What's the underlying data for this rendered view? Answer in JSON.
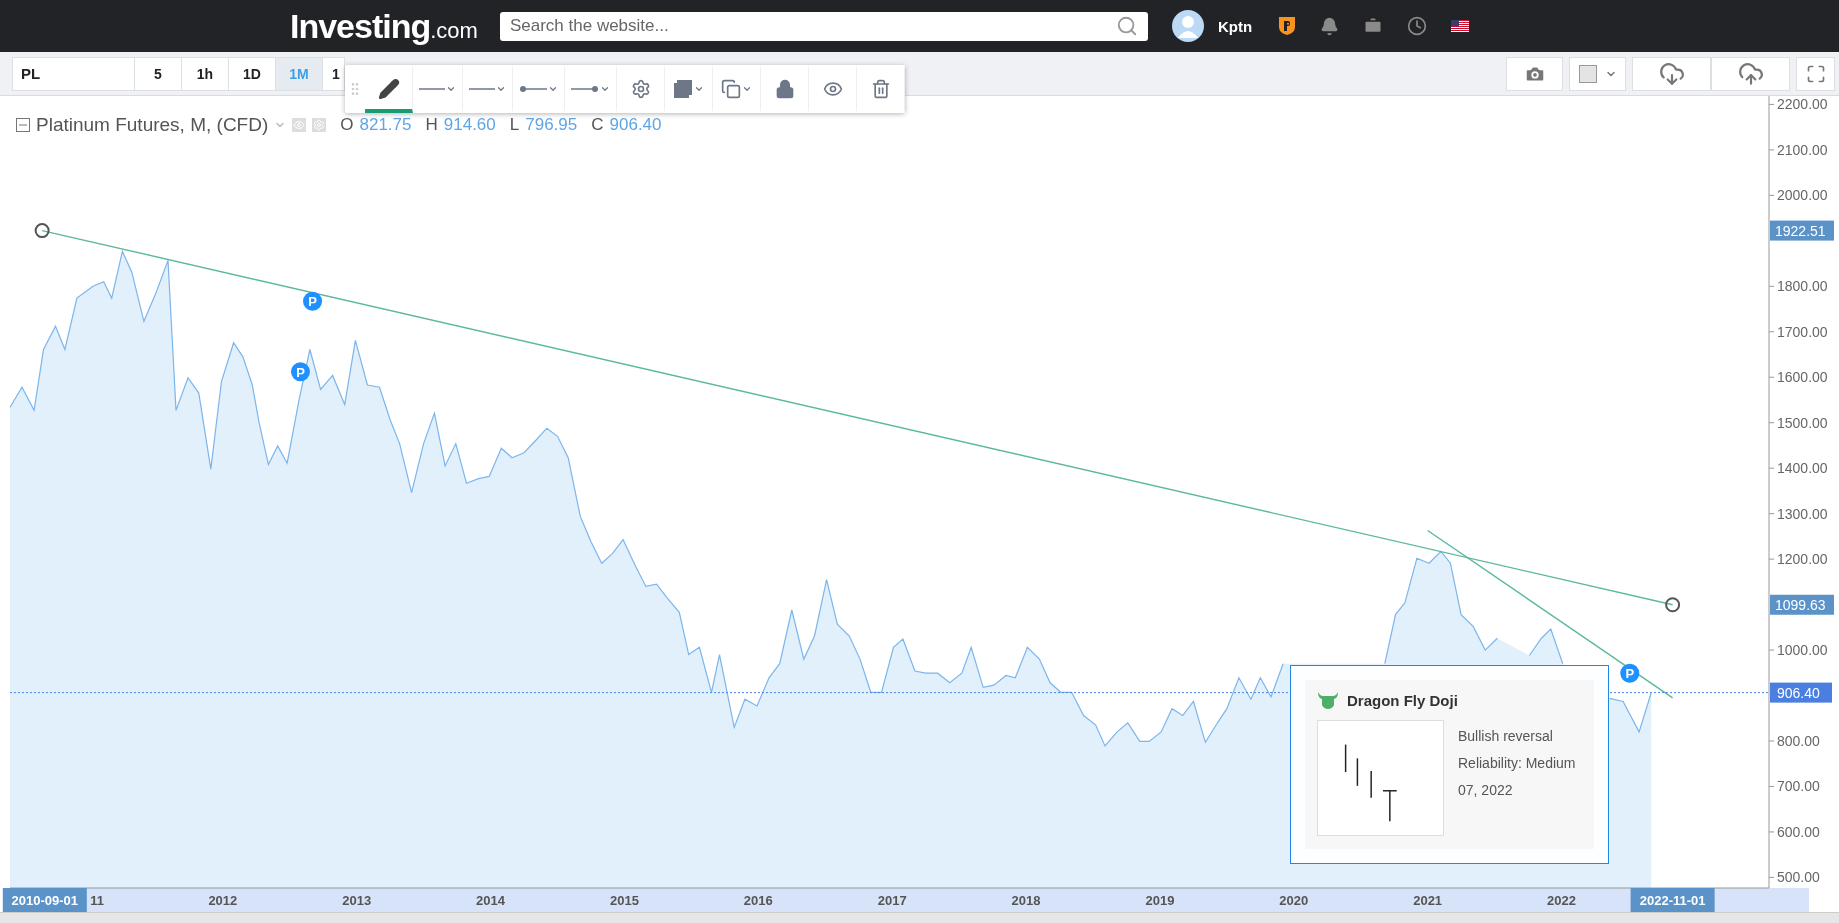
{
  "header": {
    "logo": {
      "name": "Investing",
      "suffix": ".com"
    },
    "search": {
      "placeholder": "Search the website..."
    },
    "user": {
      "name": "Kptn"
    }
  },
  "toolbar": {
    "symbol": "PL",
    "intervals": [
      {
        "label": "5",
        "selected": false
      },
      {
        "label": "1h",
        "selected": false
      },
      {
        "label": "1D",
        "selected": false
      },
      {
        "label": "1M",
        "selected": true
      },
      {
        "label": "1",
        "selected": false
      }
    ]
  },
  "drawing_toolbar": {
    "tools": [
      {
        "kind": "pencil",
        "selected": true
      },
      {
        "kind": "line-style",
        "selected": false
      },
      {
        "kind": "line-style",
        "selected": false
      },
      {
        "kind": "line-start",
        "selected": false
      },
      {
        "kind": "line-end",
        "selected": false
      },
      {
        "kind": "settings",
        "selected": false
      },
      {
        "kind": "fill",
        "selected": false
      },
      {
        "kind": "clone",
        "selected": false
      },
      {
        "kind": "lock",
        "selected": false
      },
      {
        "kind": "visibility",
        "selected": false
      },
      {
        "kind": "delete",
        "selected": false
      }
    ]
  },
  "legend": {
    "title": "Platinum Futures, M, (CFD)",
    "ohlc": [
      {
        "key": "O",
        "value": "821.75"
      },
      {
        "key": "H",
        "value": "914.60"
      },
      {
        "key": "L",
        "value": "796.95"
      },
      {
        "key": "C",
        "value": "906.40"
      }
    ]
  },
  "chart": {
    "chart_data": {
      "type": "area",
      "xlim": [
        2010.41,
        2023.55
      ],
      "ylim": [
        476.7,
        2218.5
      ],
      "x": [
        2010.41,
        2010.5,
        2010.59,
        2010.66,
        2010.75,
        2010.82,
        2010.91,
        2011.03,
        2011.11,
        2011.17,
        2011.25,
        2011.32,
        2011.41,
        2011.5,
        2011.59,
        2011.65,
        2011.74,
        2011.82,
        2011.91,
        2011.99,
        2012.08,
        2012.15,
        2012.22,
        2012.27,
        2012.34,
        2012.41,
        2012.48,
        2012.57,
        2012.65,
        2012.73,
        2012.82,
        2012.91,
        2012.99,
        2013.08,
        2013.17,
        2013.25,
        2013.32,
        2013.41,
        2013.5,
        2013.58,
        2013.66,
        2013.74,
        2013.82,
        2013.91,
        2013.99,
        2014.08,
        2014.16,
        2014.25,
        2014.34,
        2014.42,
        2014.5,
        2014.58,
        2014.67,
        2014.75,
        2014.83,
        2014.91,
        2014.99,
        2015.08,
        2015.16,
        2015.24,
        2015.32,
        2015.41,
        2015.48,
        2015.56,
        2015.65,
        2015.71,
        2015.82,
        2015.9,
        2015.99,
        2016.08,
        2016.16,
        2016.25,
        2016.34,
        2016.42,
        2016.51,
        2016.59,
        2016.68,
        2016.76,
        2016.84,
        2016.92,
        2017.01,
        2017.08,
        2017.17,
        2017.25,
        2017.34,
        2017.43,
        2017.52,
        2017.59,
        2017.68,
        2017.76,
        2017.85,
        2017.92,
        2018.01,
        2018.1,
        2018.18,
        2018.26,
        2018.34,
        2018.43,
        2018.52,
        2018.59,
        2018.68,
        2018.76,
        2018.85,
        2018.92,
        2019.01,
        2019.09,
        2019.17,
        2019.25,
        2019.34,
        2019.43,
        2019.5,
        2019.59,
        2019.68,
        2019.75,
        2019.83,
        2019.92,
        2020.01,
        2020.08,
        2020.17,
        2020.25,
        2020.34,
        2020.43,
        2020.52,
        2020.59,
        2020.68,
        2020.76,
        2020.83,
        2020.92,
        2021.01,
        2021.1,
        2021.17,
        2021.25,
        2021.34,
        2021.43,
        2021.52,
        2021.59,
        2021.68,
        2021.76,
        2021.85,
        2021.92,
        2022.01,
        2022.1,
        2022.18,
        2022.27,
        2022.36,
        2022.46,
        2022.58,
        2022.67
      ],
      "series": [
        {
          "color": "#7cb5ec",
          "values": [
            1534,
            1578,
            1527,
            1661,
            1712,
            1661,
            1774,
            1800,
            1810,
            1774,
            1877,
            1831,
            1723,
            1785,
            1857,
            1527,
            1599,
            1565,
            1398,
            1591,
            1676,
            1645,
            1583,
            1501,
            1408,
            1449,
            1411,
            1552,
            1661,
            1573,
            1604,
            1540,
            1681,
            1583,
            1578,
            1506,
            1454,
            1346,
            1454,
            1521,
            1405,
            1454,
            1367,
            1377,
            1382,
            1444,
            1423,
            1434,
            1462,
            1488,
            1470,
            1423,
            1294,
            1238,
            1191,
            1212,
            1243,
            1186,
            1140,
            1145,
            1114,
            1083,
            990,
            1006,
            907,
            990,
            830,
            892,
            877,
            939,
            970,
            1088,
            980,
            1031,
            1155,
            1057,
            1031,
            980,
            907,
            907,
            1006,
            1024,
            954,
            949,
            949,
            928,
            949,
            1006,
            918,
            923,
            944,
            939,
            1006,
            980,
            928,
            907,
            907,
            856,
            835,
            789,
            820,
            840,
            799,
            799,
            820,
            871,
            856,
            887,
            797,
            840,
            871,
            939,
            892,
            939,
            897,
            970,
            null,
            null,
            null,
            null,
            null,
            null,
            null,
            null,
            970,
            1078,
            1104,
            1202,
            1191,
            1217,
            1191,
            1078,
            1052,
            1000,
            1026,
            null,
            null,
            988,
            1026,
            1046,
            970,
            null,
            null,
            null,
            894,
            887,
            820,
            906
          ]
        }
      ],
      "xticks": [
        {
          "value": 2012,
          "label": "2012"
        },
        {
          "value": 2013,
          "label": "2013"
        },
        {
          "value": 2014,
          "label": "2014"
        },
        {
          "value": 2015,
          "label": "2015"
        },
        {
          "value": 2016,
          "label": "2016"
        },
        {
          "value": 2017,
          "label": "2017"
        },
        {
          "value": 2018,
          "label": "2018"
        },
        {
          "value": 2019,
          "label": "2019"
        },
        {
          "value": 2020,
          "label": "2020"
        },
        {
          "value": 2021,
          "label": "2021"
        },
        {
          "value": 2022,
          "label": "2022"
        }
      ],
      "yticks": [
        {
          "value": 2200,
          "label": "2200.00"
        },
        {
          "value": 2100,
          "label": "2100.00"
        },
        {
          "value": 2000,
          "label": "2000.00"
        },
        {
          "value": 1800,
          "label": "1800.00"
        },
        {
          "value": 1700,
          "label": "1700.00"
        },
        {
          "value": 1600,
          "label": "1600.00"
        },
        {
          "value": 1500,
          "label": "1500.00"
        },
        {
          "value": 1400,
          "label": "1400.00"
        },
        {
          "value": 1300,
          "label": "1300.00"
        },
        {
          "value": 1200,
          "label": "1200.00"
        },
        {
          "value": 1000,
          "label": "1000.00"
        },
        {
          "value": 800,
          "label": "800.00"
        },
        {
          "value": 700,
          "label": "700.00"
        },
        {
          "value": 600,
          "label": "600.00"
        },
        {
          "value": 500,
          "label": "500.00"
        }
      ]
    },
    "price_labels": [
      "1922.51",
      "1099.63"
    ],
    "markers": [
      "P",
      "P",
      "P"
    ],
    "date_labels": [
      "2010-09-01",
      "2022-11-01"
    ],
    "partial_tick_labels": [
      "11"
    ],
    "last_price_label": "906.40"
  },
  "pattern_popup": {
    "title": "Dragon Fly Doji",
    "lines": [
      "Bullish reversal",
      "Reliability: Medium",
      "07, 2022"
    ]
  }
}
